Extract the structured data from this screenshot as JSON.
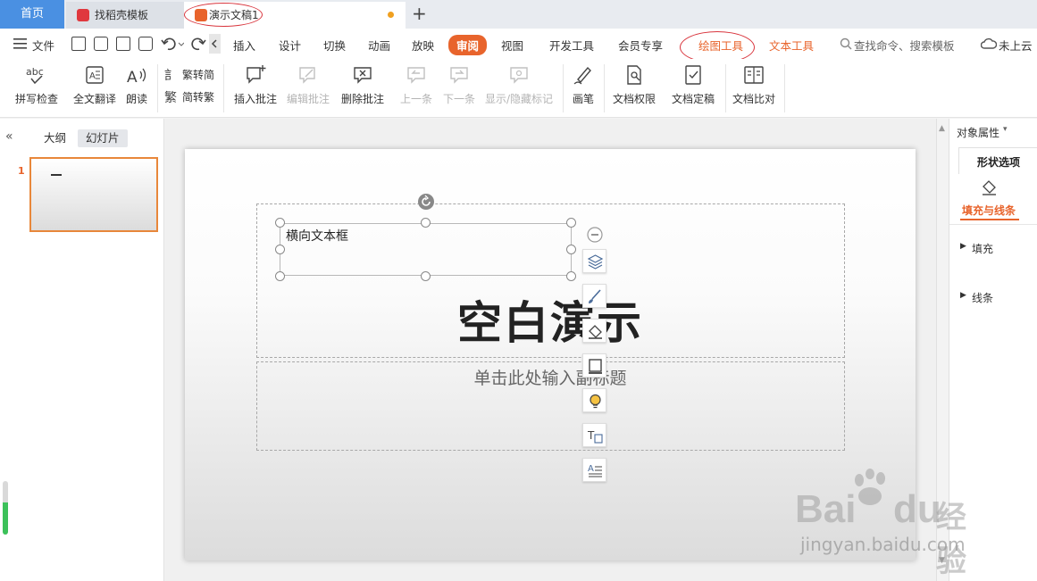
{
  "tabs": {
    "home": "首页",
    "template": "找稻壳模板",
    "doc": "演示文稿1",
    "new_tab": "+"
  },
  "menu": {
    "file": "文件",
    "items": [
      "插入",
      "设计",
      "切换",
      "动画",
      "放映",
      "审阅",
      "视图",
      "开发工具",
      "会员专享",
      "绘图工具",
      "文本工具"
    ],
    "search": "查找命令、搜索模板",
    "cloud": "未上云"
  },
  "ribbon": {
    "spell": "拼写检查",
    "translate": "全文翻译",
    "read": "朗读",
    "trad": "繁转简",
    "simp": "简转繁",
    "insert_comment": "插入批注",
    "edit_comment": "编辑批注",
    "delete_comment": "删除批注",
    "prev": "上一条",
    "next": "下一条",
    "show_hide": "显示/隐藏标记",
    "pen": "画笔",
    "permission": "文档权限",
    "finalize": "文档定稿",
    "compare": "文档比对"
  },
  "left_pane": {
    "outline": "大纲",
    "slides": "幻灯片",
    "slide_num": "1"
  },
  "slide": {
    "textbox": "横向文本框",
    "title": "空白演示",
    "subtitle": "单击此处输入副标题"
  },
  "right_panel": {
    "props": "对象属性",
    "shape_tab": "形状选项",
    "fill_line": "填充与线条",
    "fill": "填充",
    "line": "线条"
  },
  "watermark": {
    "brand": "Bai",
    "brand2": "du",
    "cn": "经验",
    "url": "jingyan.baidu.com"
  },
  "colors": {
    "accent": "#e8642c",
    "home_tab": "#4a90e2",
    "annotation": "#d9363e"
  }
}
